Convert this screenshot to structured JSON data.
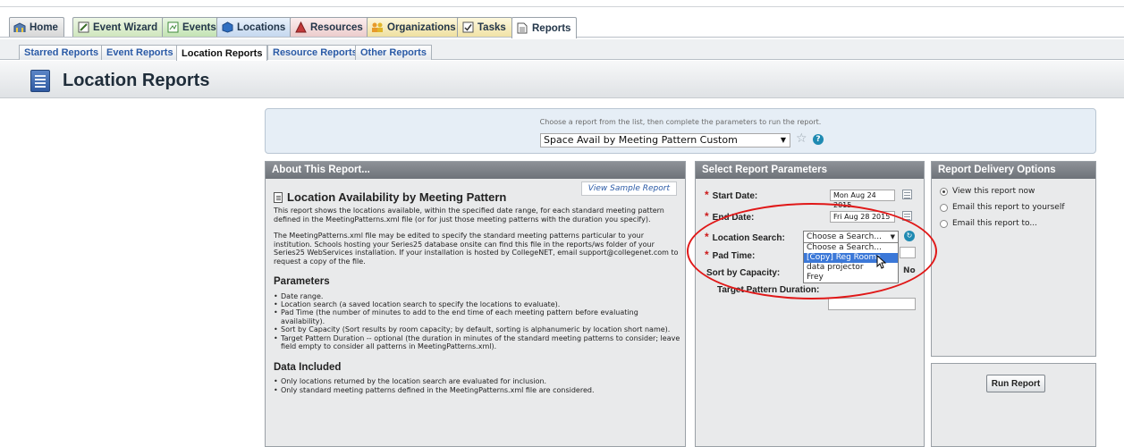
{
  "main_tabs": [
    {
      "label": "Home",
      "icon": "home-icon"
    },
    {
      "label": "Event Wizard",
      "icon": "wizard-icon"
    },
    {
      "label": "Events",
      "icon": "events-icon"
    },
    {
      "label": "Locations",
      "icon": "location-icon"
    },
    {
      "label": "Resources",
      "icon": "resources-icon"
    },
    {
      "label": "Organizations",
      "icon": "organizations-icon"
    },
    {
      "label": "Tasks",
      "icon": "tasks-icon"
    },
    {
      "label": "Reports",
      "icon": "reports-icon",
      "active": true
    }
  ],
  "sub_tabs": [
    {
      "label": "Starred Reports"
    },
    {
      "label": "Event Reports"
    },
    {
      "label": "Location Reports",
      "active": true
    },
    {
      "label": "Resource Reports"
    },
    {
      "label": "Other Reports"
    }
  ],
  "page": {
    "title": "Location Reports"
  },
  "chooser": {
    "hint": "Choose a report from the list, then complete the parameters to run the report.",
    "selected_report": "Space Avail by Meeting Pattern Custom"
  },
  "about": {
    "header": "About This Report...",
    "sample_link": "View Sample Report",
    "title": "Location Availability by Meeting Pattern",
    "para1": "This report shows the locations available, within the specified date range, for each standard meeting pattern defined in the MeetingPatterns.xml file (or for just those meeting patterns with the duration you specify).",
    "para2": "The MeetingPatterns.xml file may be edited to specify the standard meeting patterns particular to your institution. Schools hosting your Series25 database onsite can find this file in the reports/ws folder of your Series25 WebServices installation. If your installation is hosted by CollegeNET, email support@collegenet.com to request a copy of the file.",
    "parameters_heading": "Parameters",
    "parameters": [
      "Date range.",
      "Location search (a saved location search to specify the locations to evaluate).",
      "Pad Time (the number of minutes to add to the end time of each meeting pattern before evaluating availability).",
      "Sort by Capacity (Sort results by room capacity; by default, sorting is alphanumeric by location short name).",
      "Target Pattern Duration -- optional (the duration in minutes of the standard meeting patterns to consider; leave field empty to consider all patterns in MeetingPatterns.xml)."
    ],
    "data_heading": "Data Included",
    "data_included": [
      "Only locations returned by the location search are evaluated for inclusion.",
      "Only standard meeting patterns defined in the MeetingPatterns.xml file are considered."
    ]
  },
  "params": {
    "header": "Select Report Parameters",
    "start_label": "Start Date:",
    "start_value": "Mon Aug 24 2015",
    "end_label": "End Date:",
    "end_value": "Fri Aug 28 2015",
    "location_label": "Location Search:",
    "location_value": "Choose a Search...",
    "location_options": [
      "Choose a Search...",
      "[Copy] Reg Rooms",
      "data projector",
      "Frey"
    ],
    "pad_label": "Pad Time:",
    "sort_label": "Sort by Capacity:",
    "sort_no": "No",
    "target_label": "Target Pattern Duration:"
  },
  "delivery": {
    "header": "Report Delivery Options",
    "options": [
      "View this report now",
      "Email this report to yourself",
      "Email this report to..."
    ],
    "selected_index": 0
  },
  "run": {
    "label": "Run Report"
  },
  "colors": {
    "accent": "#2a5aa6",
    "panel_header": "#7d8288",
    "annotation": "#e01818"
  }
}
